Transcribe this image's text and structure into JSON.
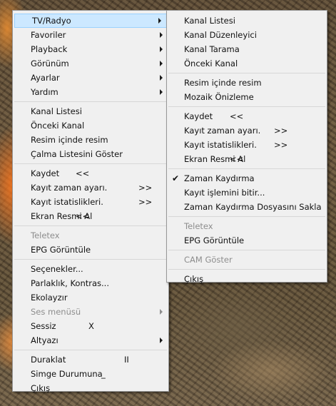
{
  "main_menu": {
    "items": [
      {
        "label": "TV/Radyo",
        "submenu": true,
        "highlighted": true
      },
      {
        "label": "Favoriler",
        "submenu": true
      },
      {
        "label": "Playback",
        "submenu": true
      },
      {
        "label": "Görünüm",
        "submenu": true
      },
      {
        "label": "Ayarlar",
        "submenu": true
      },
      {
        "label": "Yardım",
        "submenu": true
      },
      {
        "separator": true
      },
      {
        "label": "Kanal Listesi"
      },
      {
        "label": "Önceki Kanal"
      },
      {
        "label": "Resim içinde resim"
      },
      {
        "label": "Çalma Listesini Göster"
      },
      {
        "separator": true
      },
      {
        "label": "Kaydet",
        "shortcut": "<<"
      },
      {
        "label": "Kayıt zaman ayarı.",
        "shortcut": ">>"
      },
      {
        "label": "Kayıt istatislikleri.",
        "shortcut": ">>"
      },
      {
        "label": "Ekran Resmi Al",
        "shortcut": "<<"
      },
      {
        "separator": true
      },
      {
        "label": "Teletex",
        "disabled": true
      },
      {
        "label": "EPG Görüntüle"
      },
      {
        "separator": true
      },
      {
        "label": "Seçenekler..."
      },
      {
        "label": "Parlaklık, Kontras..."
      },
      {
        "label": "Ekolayzır"
      },
      {
        "label": "Ses menüsü",
        "submenu": true,
        "disabled": true
      },
      {
        "label": "Sessiz",
        "shortcut": "X"
      },
      {
        "label": "Altyazı",
        "submenu": true
      },
      {
        "separator": true
      },
      {
        "label": "Duraklat",
        "shortcut": "II"
      },
      {
        "label": "Simge Durumuna",
        "shortcut": "_"
      },
      {
        "label": "Çıkış"
      }
    ]
  },
  "sub_menu": {
    "items": [
      {
        "label": "Kanal Listesi"
      },
      {
        "label": "Kanal Düzenleyici"
      },
      {
        "label": "Kanal Tarama"
      },
      {
        "label": "Önceki Kanal"
      },
      {
        "separator": true
      },
      {
        "label": "Resim içinde resim"
      },
      {
        "label": "Mozaik Önizleme"
      },
      {
        "separator": true
      },
      {
        "label": "Kaydet",
        "shortcut": "<<"
      },
      {
        "label": "Kayıt zaman ayarı.",
        "shortcut": ">>"
      },
      {
        "label": "Kayıt istatislikleri.",
        "shortcut": ">>"
      },
      {
        "label": "Ekran Resmi Al",
        "shortcut": "<<"
      },
      {
        "separator": true
      },
      {
        "label": "Zaman Kaydırma",
        "checked": true
      },
      {
        "label": "Kayıt işlemini bitir..."
      },
      {
        "label": "Zaman Kaydırma Dosyasını Sakla"
      },
      {
        "separator": true
      },
      {
        "label": "Teletex",
        "disabled": true
      },
      {
        "label": "EPG Görüntüle"
      },
      {
        "separator": true
      },
      {
        "label": "CAM Göster",
        "disabled": true
      },
      {
        "separator": true
      },
      {
        "label": "Çıkış"
      }
    ]
  },
  "colors": {
    "menu_bg": "#f0f0f0",
    "highlight_bg": "#cce8ff",
    "highlight_border": "#99d1ff",
    "disabled_text": "#8d8d8d"
  }
}
